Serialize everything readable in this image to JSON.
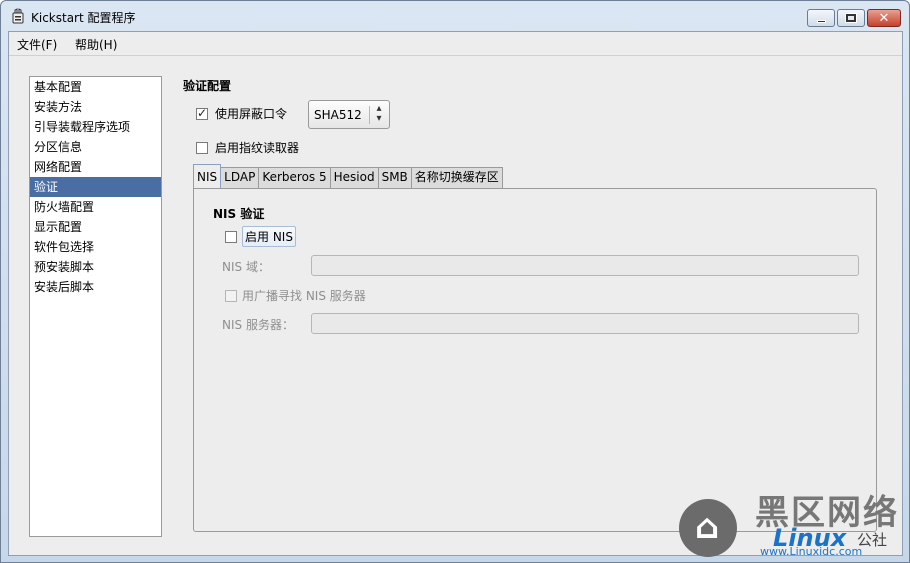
{
  "window": {
    "title": "Kickstart 配置程序",
    "controls": {
      "minimize": "minimize-icon",
      "maximize": "maximize-icon",
      "close": "close-icon"
    }
  },
  "menubar": {
    "items": [
      {
        "label": "文件(F)"
      },
      {
        "label": "帮助(H)"
      }
    ]
  },
  "sidebar": {
    "selected_index": 5,
    "items": [
      {
        "label": "基本配置"
      },
      {
        "label": "安装方法"
      },
      {
        "label": "引导装载程序选项"
      },
      {
        "label": "分区信息"
      },
      {
        "label": "网络配置"
      },
      {
        "label": "验证"
      },
      {
        "label": "防火墙配置"
      },
      {
        "label": "显示配置"
      },
      {
        "label": "软件包选择"
      },
      {
        "label": "预安装脚本"
      },
      {
        "label": "安装后脚本"
      }
    ]
  },
  "auth": {
    "section_title": "验证配置",
    "shadow_passwords": {
      "label": "使用屏蔽口令",
      "checked": true
    },
    "hash_combo": {
      "value": "SHA512"
    },
    "fingerprint": {
      "label": "启用指纹读取器",
      "checked": false
    }
  },
  "tabs": {
    "active_index": 0,
    "items": [
      {
        "label": "NIS"
      },
      {
        "label": "LDAP"
      },
      {
        "label": "Kerberos 5"
      },
      {
        "label": "Hesiod"
      },
      {
        "label": "SMB"
      },
      {
        "label": "名称切换缓存区"
      }
    ]
  },
  "nis": {
    "title": "NIS 验证",
    "enable": {
      "label": "启用 NIS",
      "checked": false
    },
    "domain_label": "NIS 域：",
    "domain_value": "",
    "broadcast": {
      "label": "用广播寻找 NIS 服务器",
      "checked": false,
      "enabled": false
    },
    "server_label": "NIS 服务器：",
    "server_value": ""
  },
  "watermark": {
    "logo_text": "黑区网络",
    "brand": "Linux",
    "suffix": "公社",
    "url": "www.Linuxidc.com"
  },
  "colors": {
    "selection": "#4a6ea4",
    "window_frame": "#c7d7ea",
    "panel_bg": "#ededed",
    "disabled_text": "#8f8f8f",
    "brand_blue": "#1a73c9"
  }
}
